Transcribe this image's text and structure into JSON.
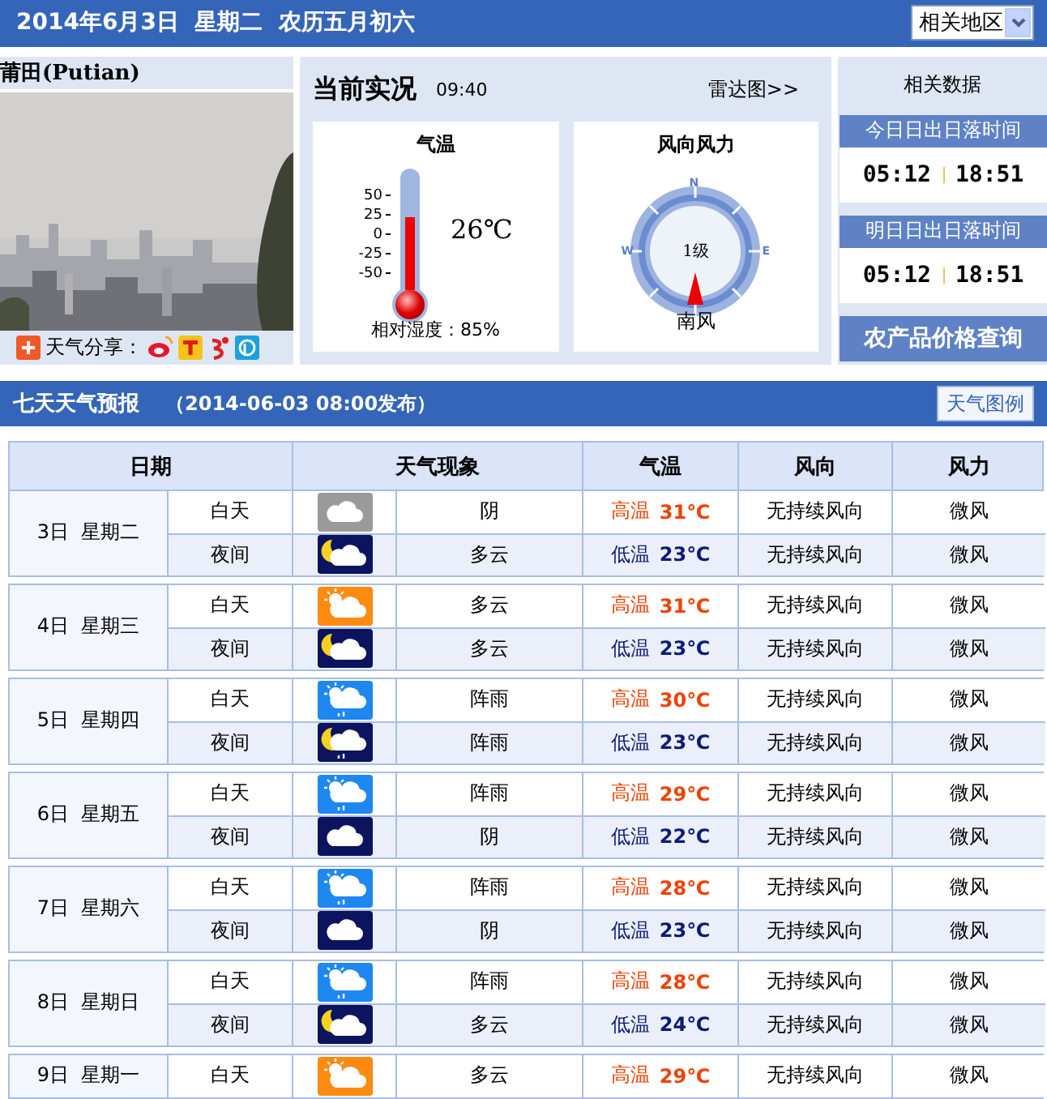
{
  "header": {
    "date": "2014年6月3日  星期二  农历五月初六",
    "region_select": "相关地区"
  },
  "city": {
    "name": "莆田(Putian)",
    "share_label": "天气分享："
  },
  "current": {
    "title": "当前实况",
    "time": "09:40",
    "radar_link": "雷达图>>",
    "temperature": {
      "title": "气温",
      "ticks": [
        "50",
        "25",
        "0",
        "-25",
        "-50"
      ],
      "level": 0.6,
      "reading": "26℃",
      "humidity": "相对湿度：85%"
    },
    "wind": {
      "title": "风向风力",
      "compass": [
        "N",
        "E",
        "W"
      ],
      "force": "1级",
      "direction": "南风"
    }
  },
  "related": {
    "title": "相关数据",
    "blocks": [
      {
        "title": "今日日出日落时间",
        "sunrise": "05:12",
        "sunset": "18:51"
      },
      {
        "title": "明日日出日落时间",
        "sunrise": "05:12",
        "sunset": "18:51"
      }
    ],
    "price_button": "农产品价格查询"
  },
  "forecast": {
    "title": "七天天气预报",
    "issued": "（2014-06-03 08:00发布）",
    "legend_button": "天气图例",
    "columns": [
      "日期",
      "天气现象",
      "气温",
      "风向",
      "风力"
    ],
    "days": [
      {
        "date": "3日  星期二",
        "periods": [
          {
            "kind": "overcast_day",
            "label": "白天",
            "weather": "阴",
            "temp_label": "高温",
            "temp": "31℃",
            "wind_dir": "无持续风向",
            "wind_force": "微风"
          },
          {
            "kind": "cloudy_night",
            "label": "夜间",
            "weather": "多云",
            "temp_label": "低温",
            "temp": "23℃",
            "wind_dir": "无持续风向",
            "wind_force": "微风"
          }
        ]
      },
      {
        "date": "4日  星期三",
        "periods": [
          {
            "kind": "cloudy_day",
            "label": "白天",
            "weather": "多云",
            "temp_label": "高温",
            "temp": "31℃",
            "wind_dir": "无持续风向",
            "wind_force": "微风"
          },
          {
            "kind": "cloudy_night",
            "label": "夜间",
            "weather": "多云",
            "temp_label": "低温",
            "temp": "23℃",
            "wind_dir": "无持续风向",
            "wind_force": "微风"
          }
        ]
      },
      {
        "date": "5日  星期四",
        "periods": [
          {
            "kind": "shower_day",
            "label": "白天",
            "weather": "阵雨",
            "temp_label": "高温",
            "temp": "30℃",
            "wind_dir": "无持续风向",
            "wind_force": "微风"
          },
          {
            "kind": "shower_night",
            "label": "夜间",
            "weather": "阵雨",
            "temp_label": "低温",
            "temp": "23℃",
            "wind_dir": "无持续风向",
            "wind_force": "微风"
          }
        ]
      },
      {
        "date": "6日  星期五",
        "periods": [
          {
            "kind": "shower_day",
            "label": "白天",
            "weather": "阵雨",
            "temp_label": "高温",
            "temp": "29℃",
            "wind_dir": "无持续风向",
            "wind_force": "微风"
          },
          {
            "kind": "overcast_night",
            "label": "夜间",
            "weather": "阴",
            "temp_label": "低温",
            "temp": "22℃",
            "wind_dir": "无持续风向",
            "wind_force": "微风"
          }
        ]
      },
      {
        "date": "7日  星期六",
        "periods": [
          {
            "kind": "shower_day",
            "label": "白天",
            "weather": "阵雨",
            "temp_label": "高温",
            "temp": "28℃",
            "wind_dir": "无持续风向",
            "wind_force": "微风"
          },
          {
            "kind": "overcast_night",
            "label": "夜间",
            "weather": "阴",
            "temp_label": "低温",
            "temp": "23℃",
            "wind_dir": "无持续风向",
            "wind_force": "微风"
          }
        ]
      },
      {
        "date": "8日  星期日",
        "periods": [
          {
            "kind": "shower_day",
            "label": "白天",
            "weather": "阵雨",
            "temp_label": "高温",
            "temp": "28℃",
            "wind_dir": "无持续风向",
            "wind_force": "微风"
          },
          {
            "kind": "cloudy_night",
            "label": "夜间",
            "weather": "多云",
            "temp_label": "低温",
            "temp": "24℃",
            "wind_dir": "无持续风向",
            "wind_force": "微风"
          }
        ]
      },
      {
        "date": "9日  星期一",
        "periods": [
          {
            "kind": "cloudy_day",
            "label": "白天",
            "weather": "多云",
            "temp_label": "高温",
            "temp": "29℃",
            "wind_dir": "无持续风向",
            "wind_force": "微风"
          }
        ]
      }
    ]
  }
}
